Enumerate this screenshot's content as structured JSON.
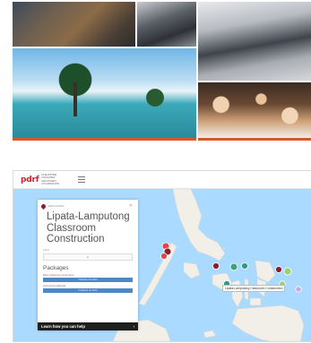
{
  "brand": {
    "logo_text": "pdrf",
    "tagline": "PHILIPPINE DISASTER RECOVERY FOUNDATION"
  },
  "project_panel": {
    "kicker": "EDUCATION",
    "title": "Lipata-Lamputong Classroom Construction",
    "field_label": "Field",
    "select_value": "1",
    "packages_title": "Packages",
    "packages": [
      {
        "label": "Basic Classroom Construction",
        "status": "Published Jan 2016"
      },
      {
        "label": "Instructional Materials",
        "status": "Published Jan 2016"
      }
    ],
    "cta_label": "Learn how you can help",
    "cta_arrow": "›"
  },
  "map": {
    "tooltip": "Lipata-Lamputong Classroom Construction",
    "marker_colors": [
      "#e04450",
      "#8b1d2c",
      "#3aa37a",
      "#9ccf6b",
      "#2d9a88",
      "#c9a9d8"
    ],
    "water_color": "#aadaff",
    "land_color": "#f2efe9"
  },
  "colors": {
    "accent": "#c8242f",
    "package_bar": "#4f86c6",
    "cta_bg": "#1e1e1e"
  }
}
